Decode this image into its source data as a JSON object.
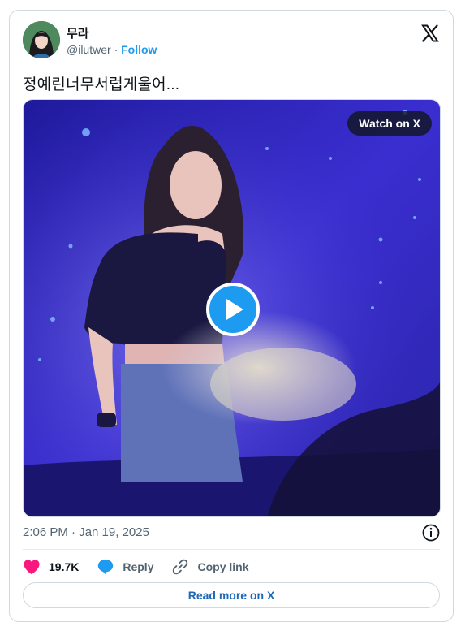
{
  "author": {
    "display_name": "무라",
    "handle": "@ilutwer",
    "separator": "·",
    "follow_label": "Follow"
  },
  "tweet": {
    "text": "정예린너무서럽게울어..."
  },
  "media": {
    "watch_label": "Watch on X"
  },
  "meta": {
    "timestamp": "2:06 PM · Jan 19, 2025"
  },
  "actions": {
    "likes": "19.7K",
    "reply_label": "Reply",
    "copy_link_label": "Copy link"
  },
  "footer": {
    "read_more_label": "Read more on X"
  },
  "colors": {
    "accent": "#1d9bf0",
    "like": "#f91880",
    "stage_bg": "#3a2ed0"
  },
  "icons": [
    "x-logo-icon",
    "play-icon",
    "info-icon",
    "heart-icon",
    "reply-bubble-icon",
    "link-icon"
  ]
}
